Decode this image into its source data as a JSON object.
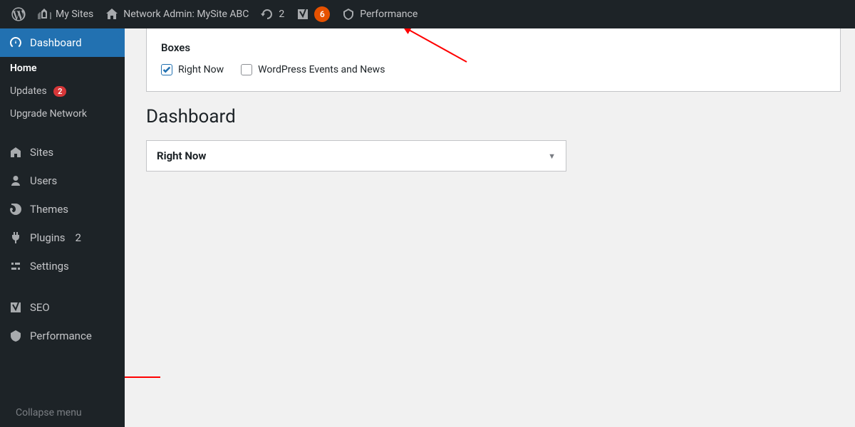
{
  "topbar": {
    "mysites_label": "My Sites",
    "network_admin_label": "Network Admin: MySite ABC",
    "update_count": "2",
    "seo_badge": "6",
    "performance_label": "Performance"
  },
  "sidebar": {
    "dashboard": {
      "label": "Dashboard"
    },
    "submenu": {
      "home": "Home",
      "updates": "Updates",
      "updates_badge": "2",
      "upgrade_network": "Upgrade Network"
    },
    "sites": "Sites",
    "users": "Users",
    "themes": "Themes",
    "plugins": "Plugins",
    "plugins_badge": "2",
    "settings": "Settings",
    "seo": "SEO",
    "performance": "Performance",
    "collapse": "Collapse menu"
  },
  "screen_options": {
    "heading": "Boxes",
    "right_now": "Right Now",
    "events_news": "WordPress Events and News",
    "right_now_checked": true,
    "events_news_checked": false
  },
  "page": {
    "title": "Dashboard"
  },
  "postbox": {
    "right_now_title": "Right Now"
  }
}
